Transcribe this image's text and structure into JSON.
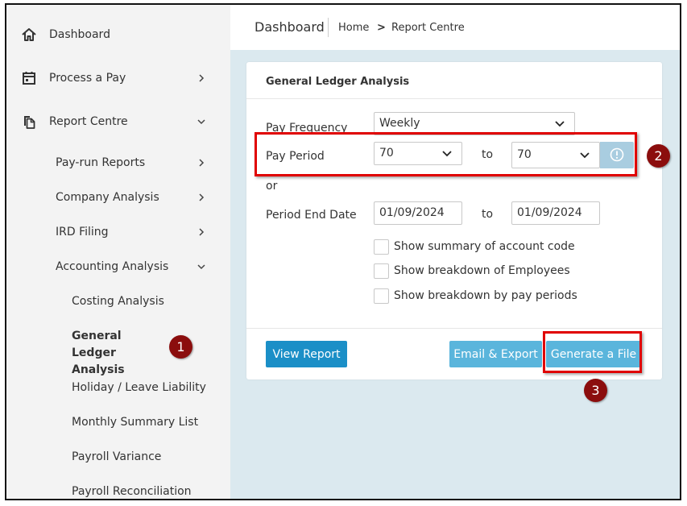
{
  "sidebar": {
    "items": [
      {
        "label": "Dashboard",
        "icon": "home-icon"
      },
      {
        "label": "Process a Pay",
        "icon": "calendar-icon"
      },
      {
        "label": "Report Centre",
        "icon": "documents-icon"
      },
      {
        "label": "Pay-run Reports"
      },
      {
        "label": "Company Analysis"
      },
      {
        "label": "IRD Filing"
      },
      {
        "label": "Accounting Analysis"
      },
      {
        "label": "Costing Analysis"
      },
      {
        "label": "General Ledger Analysis"
      },
      {
        "label": "Holiday / Leave Liability"
      },
      {
        "label": "Monthly Summary List"
      },
      {
        "label": "Payroll Variance"
      },
      {
        "label": "Payroll Reconciliation"
      }
    ]
  },
  "header": {
    "title": "Dashboard",
    "breadcrumb": {
      "home": "Home",
      "separator": ">",
      "current": "Report Centre"
    }
  },
  "card": {
    "title": "General Ledger Analysis",
    "pay_frequency": {
      "label": "Pay Frequency",
      "value": "Weekly"
    },
    "pay_period": {
      "label": "Pay Period",
      "from": "70",
      "to_label": "to",
      "to": "70"
    },
    "or_label": "or",
    "period_end_date": {
      "label": "Period End Date",
      "from": "01/09/2024",
      "to_label": "to",
      "to": "01/09/2024"
    },
    "checkboxes": [
      {
        "label": "Show summary of account code",
        "checked": false
      },
      {
        "label": "Show breakdown of Employees",
        "checked": false
      },
      {
        "label": "Show breakdown by pay periods",
        "checked": false
      }
    ],
    "buttons": {
      "view": "View Report",
      "email": "Email & Export",
      "generate": "Generate a File"
    }
  },
  "annotations": {
    "marker1": "1",
    "marker2": "2",
    "marker3": "3"
  },
  "colors": {
    "primary_button": "#1b8fc7",
    "secondary_button": "#5ab5dc",
    "annotation_red": "#e00000",
    "marker": "#8b0d0d",
    "content_bg": "#dbe9ef"
  }
}
